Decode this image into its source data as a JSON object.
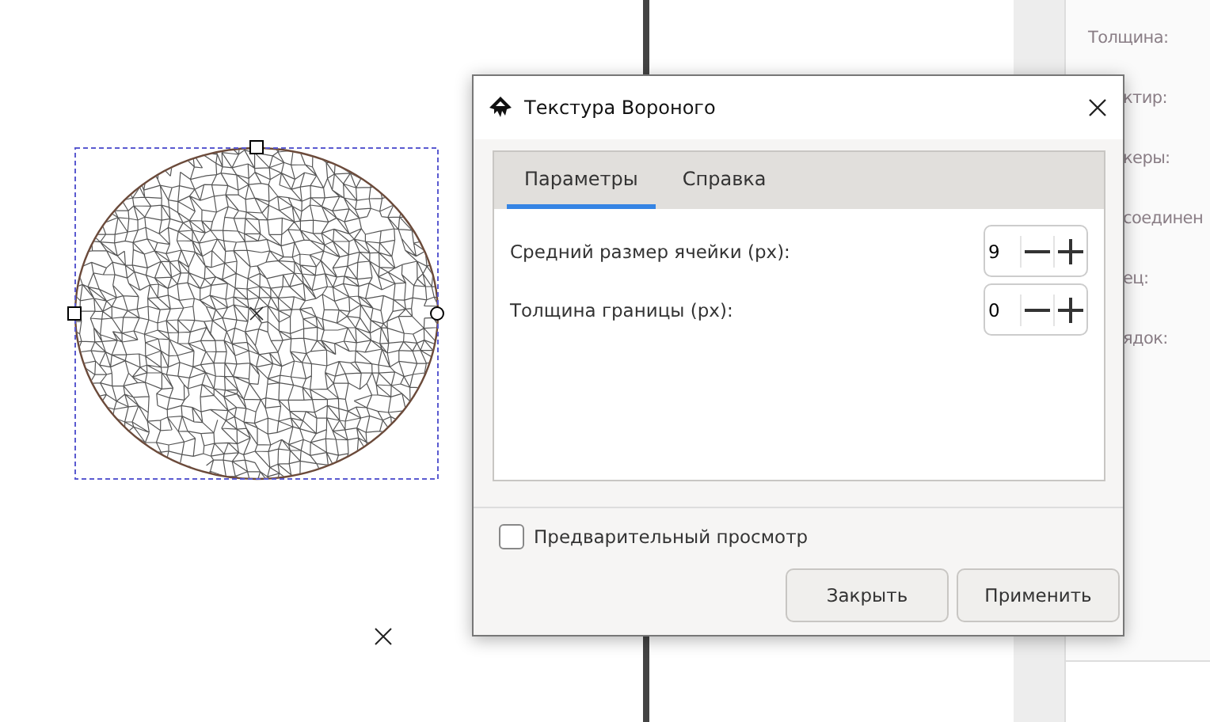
{
  "dialog": {
    "title": "Текстура Вороного",
    "tabs": [
      {
        "label": "Параметры",
        "selected": true
      },
      {
        "label": "Справка",
        "selected": false
      }
    ],
    "fields": [
      {
        "label": "Средний размер ячейки (px):",
        "value": "9"
      },
      {
        "label": "Толщина границы (px):",
        "value": "0"
      }
    ],
    "preview": {
      "label": "Предварительный просмотр",
      "checked": false
    },
    "buttons": [
      "Закрыть",
      "Применить"
    ]
  },
  "side_panel": {
    "labels": [
      "Толщина:",
      "ктир:",
      "керы:",
      "соединен",
      "ец:",
      "ядок:"
    ]
  }
}
